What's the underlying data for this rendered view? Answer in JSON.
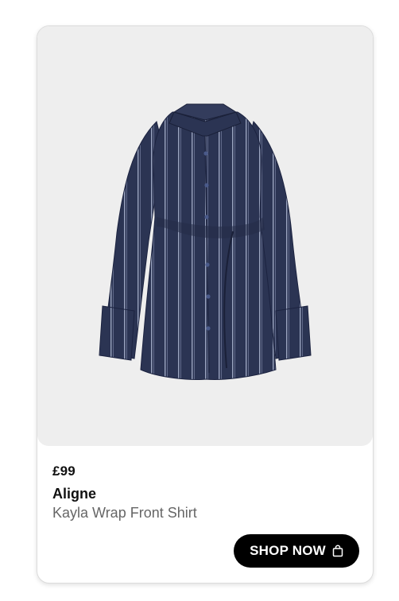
{
  "product": {
    "price": "£99",
    "brand": "Aligne",
    "name": "Kayla Wrap Front Shirt",
    "image_subject": "navy pinstripe wrap front shirt dress"
  },
  "cta": {
    "label": "SHOP NOW",
    "icon": "shopping-bag-icon"
  },
  "colors": {
    "background": "#ffffff",
    "image_background": "#eeeeee",
    "garment_navy": "#2b3453",
    "stripe": "#9aa4bf",
    "button": "#000000",
    "button_text": "#ffffff",
    "secondary_text": "#666666"
  }
}
